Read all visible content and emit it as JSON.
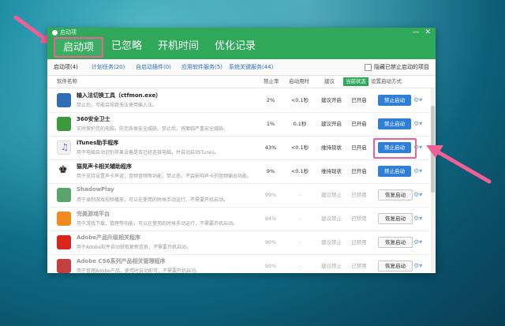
{
  "window": {
    "title": "启动项",
    "controls": [
      "—",
      "✕"
    ]
  },
  "main_tabs": [
    {
      "label": "启动项"
    },
    {
      "label": "已忽略"
    },
    {
      "label": "开机时间"
    },
    {
      "label": "优化记录"
    }
  ],
  "sub_tabs": [
    {
      "label": "启动项(4)"
    },
    {
      "label": "计划任务(20)"
    },
    {
      "label": "自启动插件(0)"
    },
    {
      "label": "应用软件服务(5)"
    },
    {
      "label": "系统关键服务(44)"
    }
  ],
  "hide_disabled_label": "隐藏已禁止启动的项目",
  "columns": {
    "name": "软件名称",
    "rate": "禁止率",
    "time": "启动用时",
    "suggestion": "建议",
    "status": "当前状态",
    "method": "设置启动方式"
  },
  "rows": [
    {
      "name": "输入法切换工具（ctfmon.exe）",
      "desc": "禁止后，可能会导致无法使用输入法。",
      "rate": "2%",
      "time": "<0.1秒",
      "suggestion": "建议开启",
      "status": "已开启",
      "action": "禁止启动",
      "icon": "keyboard-icon"
    },
    {
      "name": "360安全卫士",
      "desc": "实时保护您的电脑，防范各类安全威胁。禁止后，将面临严重安全威胁。",
      "rate": "1%",
      "time": "0.1秒",
      "suggestion": "建议开启",
      "status": "已开启",
      "action": "禁止启动",
      "icon": "shield-icon"
    },
    {
      "name": "iTunes助手程序",
      "desc": "用于电脑自动识别苹果设备是否已经连接电脑，并自动启动iTunes。",
      "rate": "43%",
      "time": "<0.1秒",
      "suggestion": "维持现状",
      "status": "已开启",
      "action": "禁止启动",
      "icon": "music-note-icon"
    },
    {
      "name": "猫晃声卡相关辅助程序",
      "desc": "用于支持设置声卡声道，音频音频等功能，禁止后，不会影响声卡的音频输出功能。",
      "rate": "9%",
      "time": "<0.1秒",
      "suggestion": "维持现状",
      "status": "已开启",
      "action": "禁止启动",
      "icon": "speaker-icon"
    },
    {
      "name": "ShadowPlay",
      "desc": "用于录制游戏视频播放，可以在使用的时候手动运行，不需要开机启动。",
      "rate": "99%",
      "time": "-",
      "suggestion": "建议禁止",
      "status": "已禁用",
      "action": "恢复启动",
      "icon": "shadowplay-icon"
    },
    {
      "name": "完美游戏平台",
      "desc": "用于游戏下载、管理等功能，可以在使用的时候手动运行，不需要开机启动。",
      "rate": "94%",
      "time": "-",
      "suggestion": "建议禁止",
      "status": "已禁用",
      "action": "恢复启动",
      "icon": "game-icon"
    },
    {
      "name": "Adobe产品升级相关程序",
      "desc": "用于Adobe软件自动获取更新信息，不需要开机启动。",
      "rate": "90%",
      "time": "-",
      "suggestion": "建议禁止",
      "status": "已禁用",
      "action": "恢复启动",
      "icon": "adobe-icon"
    },
    {
      "name": "Adobe CS6系列产品相关管理程序",
      "desc": "用于管理Adobe产品，使用时自动即可，不需要开机启动。",
      "rate": "90%",
      "time": "-",
      "suggestion": "建议禁止",
      "status": "已禁用",
      "action": "恢复启动",
      "icon": "adobe-cs-icon"
    }
  ],
  "colors": {
    "accent_green": "#2fa85a",
    "primary_blue": "#2f7fd9",
    "highlight_pink": "#f25f94"
  }
}
